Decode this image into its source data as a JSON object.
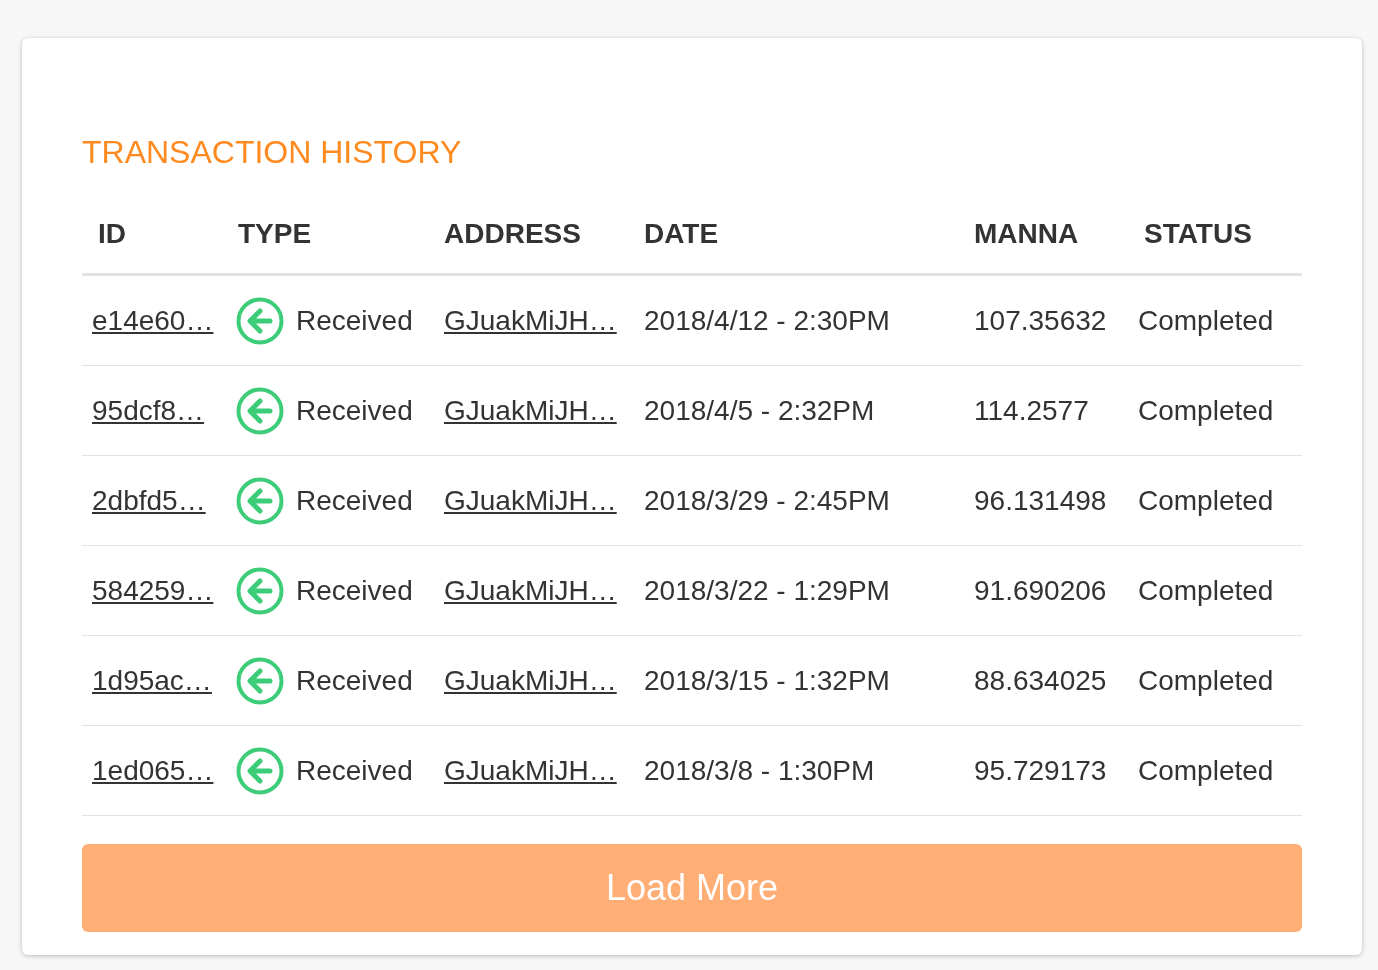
{
  "title": "TRANSACTION HISTORY",
  "columns": [
    "ID",
    "TYPE",
    "ADDRESS",
    "DATE",
    "MANNA",
    "STATUS"
  ],
  "rows": [
    {
      "id": "e14e60…",
      "type": "Received",
      "address": "GJuakMiJH…",
      "date": "2018/4/12 - 2:30PM",
      "manna": "107.35632",
      "status": "Completed"
    },
    {
      "id": "95dcf8…",
      "type": "Received",
      "address": "GJuakMiJH…",
      "date": "2018/4/5 - 2:32PM",
      "manna": "114.2577",
      "status": "Completed"
    },
    {
      "id": "2dbfd5…",
      "type": "Received",
      "address": "GJuakMiJH…",
      "date": "2018/3/29 - 2:45PM",
      "manna": "96.131498",
      "status": "Completed"
    },
    {
      "id": "584259…",
      "type": "Received",
      "address": "GJuakMiJH…",
      "date": "2018/3/22 - 1:29PM",
      "manna": "91.690206",
      "status": "Completed"
    },
    {
      "id": "1d95ac…",
      "type": "Received",
      "address": "GJuakMiJH…",
      "date": "2018/3/15 - 1:32PM",
      "manna": "88.634025",
      "status": "Completed"
    },
    {
      "id": "1ed065…",
      "type": "Received",
      "address": "GJuakMiJH…",
      "date": "2018/3/8 - 1:30PM",
      "manna": "95.729173",
      "status": "Completed"
    }
  ],
  "load_more": "Load More"
}
